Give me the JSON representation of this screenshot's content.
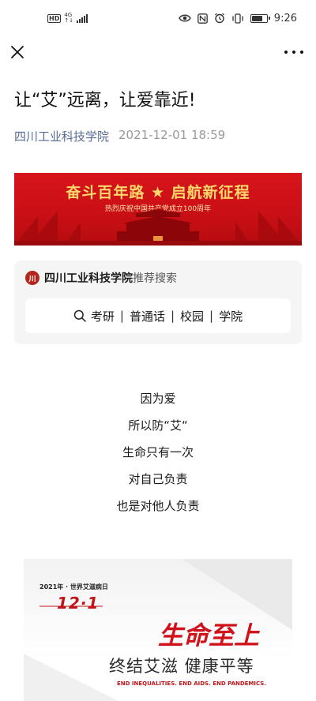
{
  "status_bar": {
    "hd_badge": "HD",
    "network": "4G",
    "time": "9:26",
    "battery_level": 0.8,
    "icons": [
      "eye-icon",
      "nfc-icon",
      "alarm-icon",
      "vibrate-icon",
      "battery-icon"
    ]
  },
  "nav": {
    "close_icon": "close-icon",
    "more_icon": "more-icon"
  },
  "article": {
    "title": "让“艾”远离，让爱靠近!",
    "account": "四川工业科技学院",
    "date": "2021-12-01 18:59"
  },
  "banner": {
    "title": "奋斗百年路 ★ 启航新征程",
    "subtitle": "热烈庆祝中国共产党成立100周年",
    "accent": "#d7151b"
  },
  "search_card": {
    "school_name": "四川工业科技学院",
    "recommend_label": "推荐搜索",
    "keywords": [
      "考研",
      "普通话",
      "校园",
      "学院"
    ],
    "search_icon": "search-icon"
  },
  "poem": [
    "因为爱",
    "所以防“艾“",
    "生命只有一次",
    "对自己负责",
    "也是对他人负责"
  ],
  "poster": {
    "caption": "2021年 · 世界艾滋病日",
    "date": "12·1",
    "slogan": "生命至上",
    "theme": "终结艾滋 健康平等",
    "english": "END INEQUALITIES. END AIDS. END PANDEMICS."
  }
}
